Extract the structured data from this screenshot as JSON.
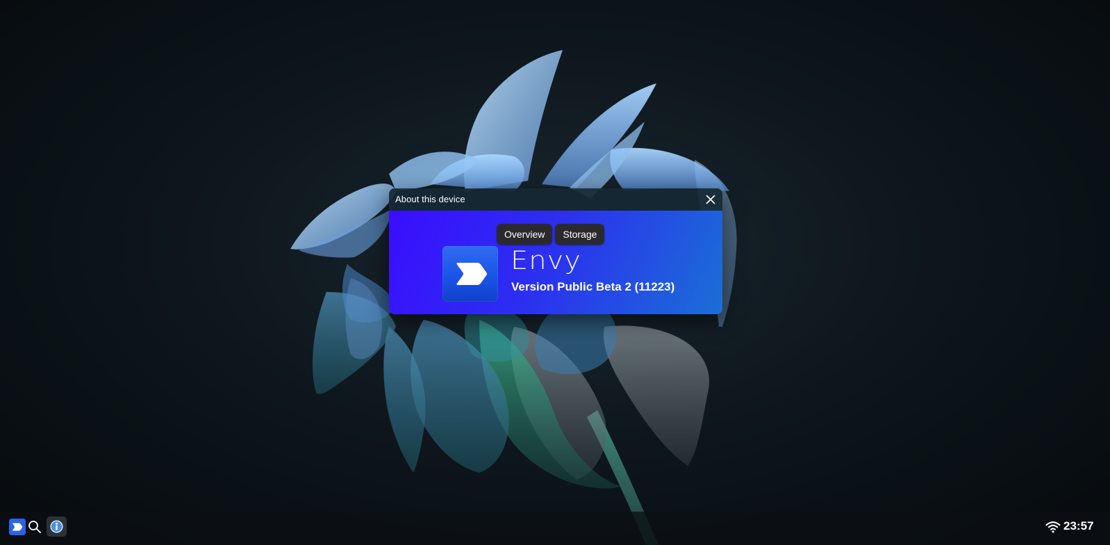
{
  "dialog": {
    "title": "About this device",
    "tabs": [
      {
        "label": "Overview"
      },
      {
        "label": "Storage"
      }
    ],
    "product_name": "Envy",
    "version": "Version Public Beta 2 (11223)",
    "icons": {
      "close": "close-icon",
      "logo": "envy-logo-icon"
    }
  },
  "taskbar": {
    "clock": "23:57",
    "icons": {
      "launcher": "envy-launcher-icon",
      "search": "search-icon",
      "about_task": "info-icon",
      "wifi": "wifi-icon"
    }
  },
  "colors": {
    "dialog_gradient_start": "#3a0dff",
    "dialog_gradient_end": "#1b6fd6",
    "tab_background": "#2a2a2e",
    "launcher_accent": "#2b63e8"
  }
}
